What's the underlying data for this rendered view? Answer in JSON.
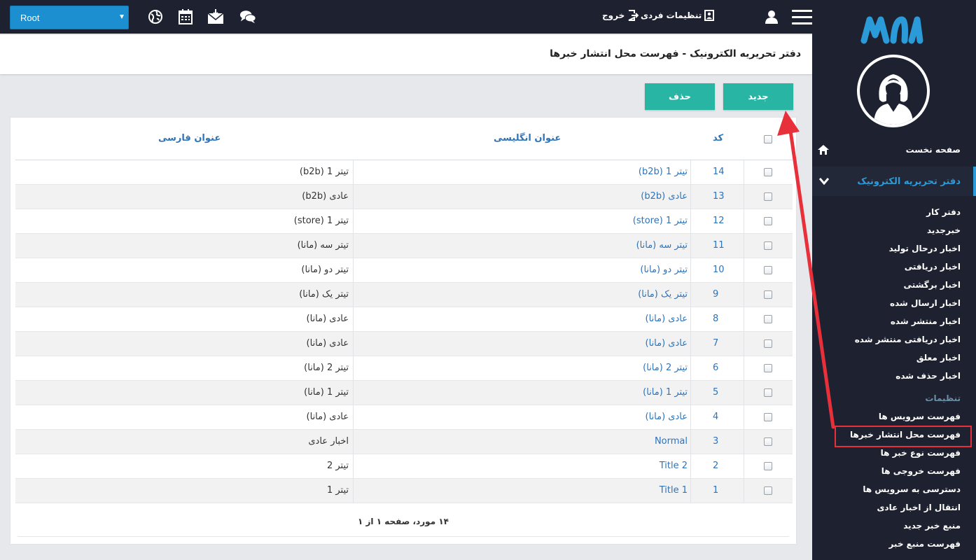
{
  "topbar": {
    "root_select": "Root",
    "logout_label": "خروج",
    "settings_label": "تنظیمات فردی",
    "icons": [
      "globe-icon",
      "calendar-icon",
      "mail-icon",
      "chat-icon",
      "user-icon",
      "menu-icon"
    ]
  },
  "header": {
    "title": "دفتر تحریریه الکترونیک - فهرست محل انتشار خبرها"
  },
  "buttons": {
    "new": "جدید",
    "delete": "حذف"
  },
  "table": {
    "columns": {
      "code": "کد",
      "english": "عنوان انگلیسی",
      "persian": "عنوان فارسی"
    },
    "rows": [
      {
        "code": "14",
        "english": "تیتر 1 (b2b)",
        "persian": "تیتر 1 (b2b)"
      },
      {
        "code": "13",
        "english": "عادی (b2b)",
        "persian": "عادی (b2b)"
      },
      {
        "code": "12",
        "english": "تیتر 1 (store)",
        "persian": "تیتر 1 (store)"
      },
      {
        "code": "11",
        "english": "تیتر سه (مانا)",
        "persian": "تیتر سه (مانا)"
      },
      {
        "code": "10",
        "english": "تیتر دو (مانا)",
        "persian": "تیتر دو (مانا)"
      },
      {
        "code": "9",
        "english": "تیتر یک (مانا)",
        "persian": "تیتر یک (مانا)"
      },
      {
        "code": "8",
        "english": "عادی (مانا)",
        "persian": "عادی (مانا)"
      },
      {
        "code": "7",
        "english": "عادی (مانا)",
        "persian": "عادی (مانا)"
      },
      {
        "code": "6",
        "english": "تیتر 2 (مانا)",
        "persian": "تیتر 2 (مانا)"
      },
      {
        "code": "5",
        "english": "تیتر 1 (مانا)",
        "persian": "تیتر 1 (مانا)"
      },
      {
        "code": "4",
        "english": "عادی (مانا)",
        "persian": "عادی (مانا)"
      },
      {
        "code": "3",
        "english": "Normal",
        "persian": "اخبار عادی"
      },
      {
        "code": "2",
        "english": "Title 2",
        "persian": "تیتر 2"
      },
      {
        "code": "1",
        "english": "Title 1",
        "persian": "تیتر 1"
      }
    ],
    "footer": "۱۴ مورد، صفحه ۱ از ۱"
  },
  "sidebar": {
    "logo_text": "مانا",
    "home": "صفحه نخست",
    "active_section": "دفتر تحریریه الکترونیک",
    "items": [
      "دفتر کار",
      "خبرجدید",
      "اخبار درحال تولید",
      "اخبار دریافتی",
      "اخبار برگشتی",
      "اخبار ارسال شده",
      "اخبار منتشر شده",
      "اخبار دریافتی منتشر شده",
      "اخبار معلق",
      "اخبار حذف شده"
    ],
    "settings_title": "تنظیمات",
    "settings_items": [
      "فهرست سرویس ها",
      "فهرست محل انتشار خبرها",
      "فهرست نوع خبر ها",
      "فهرست خروجی ها",
      "دسترسی به سرویس ها",
      "انتقال از اخبار عادی",
      "منبع خبر جدید",
      "فهرست منبع خبر"
    ]
  },
  "colors": {
    "topbar": "#1e2230",
    "accent": "#2a9bd8",
    "button": "#29b5a3",
    "annotation": "#e8303a"
  }
}
